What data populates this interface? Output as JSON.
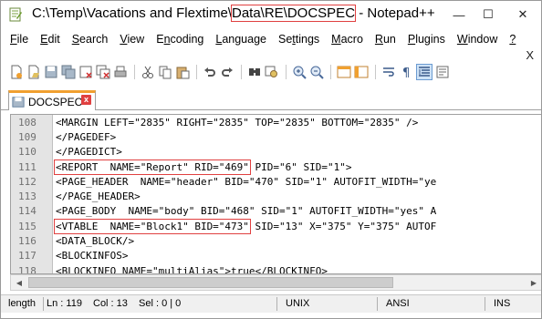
{
  "window": {
    "title_prefix": "C:\\Temp\\Vacations and Flextime\\",
    "title_highlight": "Data\\RE\\DOCSPEC",
    "title_suffix": " - Notepad++",
    "minimize": "—",
    "maximize": "☐",
    "close": "✕"
  },
  "menu": {
    "items": [
      {
        "u": "F",
        "rest": "ile"
      },
      {
        "u": "E",
        "rest": "dit"
      },
      {
        "u": "S",
        "rest": "earch"
      },
      {
        "u": "V",
        "rest": "iew"
      },
      {
        "u": "n",
        "pre": "E",
        "rest": "coding"
      },
      {
        "u": "L",
        "rest": "anguage"
      },
      {
        "u": "t",
        "pre": "Se",
        "rest": "tings"
      },
      {
        "u": "M",
        "rest": "acro"
      },
      {
        "u": "R",
        "rest": "un"
      },
      {
        "u": "P",
        "rest": "lugins"
      },
      {
        "u": "W",
        "rest": "indow"
      },
      {
        "u": "?",
        "rest": ""
      }
    ],
    "close_doc": "X"
  },
  "toolbar": {
    "icons": [
      "new-file-icon",
      "open-file-icon",
      "save-icon",
      "save-all-icon",
      "close-icon",
      "close-all-icon",
      "print-icon",
      "cut-icon",
      "copy-icon",
      "paste-icon",
      "undo-icon",
      "redo-icon",
      "find-icon",
      "replace-icon",
      "zoom-in-icon",
      "zoom-out-icon",
      "sync-vertical-icon",
      "sync-horizontal-icon",
      "word-wrap-icon",
      "show-all-chars-icon",
      "indent-guide-icon",
      "lang-icon"
    ]
  },
  "tab": {
    "label": "DOCSPEC",
    "close": "x"
  },
  "editor": {
    "lines": [
      {
        "n": "108",
        "text": "<MARGIN LEFT=\"2835\" RIGHT=\"2835\" TOP=\"2835\" BOTTOM=\"2835\" />"
      },
      {
        "n": "109",
        "text": "</PAGEDEF>"
      },
      {
        "n": "110",
        "text": "</PAGEDICT>"
      },
      {
        "n": "111",
        "mark": "<REPORT  NAME=\"Report\" RID=\"469\"",
        "text": " PID=\"6\" SID=\"1\">"
      },
      {
        "n": "112",
        "text": "<PAGE_HEADER  NAME=\"header\" BID=\"470\" SID=\"1\" AUTOFIT_WIDTH=\"ye"
      },
      {
        "n": "113",
        "text": "</PAGE_HEADER>"
      },
      {
        "n": "114",
        "text": "<PAGE_BODY  NAME=\"body\" BID=\"468\" SID=\"1\" AUTOFIT_WIDTH=\"yes\" A"
      },
      {
        "n": "115",
        "mark": "<VTABLE  NAME=\"Block1\" BID=\"473\"",
        "text": " SID=\"13\" X=\"375\" Y=\"375\" AUTOF"
      },
      {
        "n": "116",
        "text": "<DATA_BLOCK/>"
      },
      {
        "n": "117",
        "text": "<BLOCKINFOS>"
      },
      {
        "n": "118",
        "text": "<BLOCKINFO NAME=\"multiAlias\">true</BLOCKINFO>"
      }
    ]
  },
  "status": {
    "length": "length",
    "ln": "Ln : 119",
    "col": "Col : 13",
    "sel": "Sel : 0 | 0",
    "eol": "UNIX",
    "encoding": "ANSI",
    "mode": "INS"
  },
  "colors": {
    "highlight_border": "#e04040",
    "tab_accent": "#f0a030"
  }
}
